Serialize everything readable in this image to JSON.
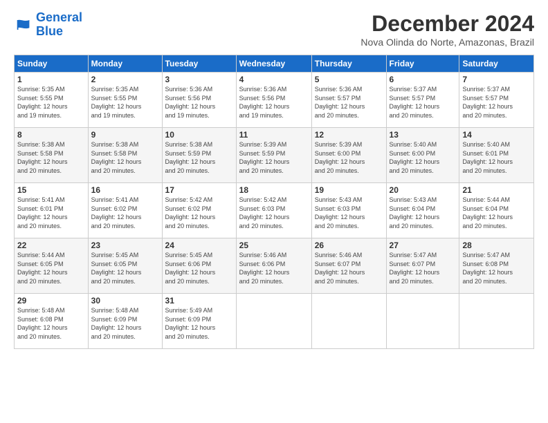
{
  "logo": {
    "line1": "General",
    "line2": "Blue"
  },
  "title": "December 2024",
  "subtitle": "Nova Olinda do Norte, Amazonas, Brazil",
  "days_of_week": [
    "Sunday",
    "Monday",
    "Tuesday",
    "Wednesday",
    "Thursday",
    "Friday",
    "Saturday"
  ],
  "weeks": [
    [
      {
        "day": "1",
        "info": "Sunrise: 5:35 AM\nSunset: 5:55 PM\nDaylight: 12 hours\nand 19 minutes."
      },
      {
        "day": "2",
        "info": "Sunrise: 5:35 AM\nSunset: 5:55 PM\nDaylight: 12 hours\nand 19 minutes."
      },
      {
        "day": "3",
        "info": "Sunrise: 5:36 AM\nSunset: 5:56 PM\nDaylight: 12 hours\nand 19 minutes."
      },
      {
        "day": "4",
        "info": "Sunrise: 5:36 AM\nSunset: 5:56 PM\nDaylight: 12 hours\nand 19 minutes."
      },
      {
        "day": "5",
        "info": "Sunrise: 5:36 AM\nSunset: 5:57 PM\nDaylight: 12 hours\nand 20 minutes."
      },
      {
        "day": "6",
        "info": "Sunrise: 5:37 AM\nSunset: 5:57 PM\nDaylight: 12 hours\nand 20 minutes."
      },
      {
        "day": "7",
        "info": "Sunrise: 5:37 AM\nSunset: 5:57 PM\nDaylight: 12 hours\nand 20 minutes."
      }
    ],
    [
      {
        "day": "8",
        "info": "Sunrise: 5:38 AM\nSunset: 5:58 PM\nDaylight: 12 hours\nand 20 minutes."
      },
      {
        "day": "9",
        "info": "Sunrise: 5:38 AM\nSunset: 5:58 PM\nDaylight: 12 hours\nand 20 minutes."
      },
      {
        "day": "10",
        "info": "Sunrise: 5:38 AM\nSunset: 5:59 PM\nDaylight: 12 hours\nand 20 minutes."
      },
      {
        "day": "11",
        "info": "Sunrise: 5:39 AM\nSunset: 5:59 PM\nDaylight: 12 hours\nand 20 minutes."
      },
      {
        "day": "12",
        "info": "Sunrise: 5:39 AM\nSunset: 6:00 PM\nDaylight: 12 hours\nand 20 minutes."
      },
      {
        "day": "13",
        "info": "Sunrise: 5:40 AM\nSunset: 6:00 PM\nDaylight: 12 hours\nand 20 minutes."
      },
      {
        "day": "14",
        "info": "Sunrise: 5:40 AM\nSunset: 6:01 PM\nDaylight: 12 hours\nand 20 minutes."
      }
    ],
    [
      {
        "day": "15",
        "info": "Sunrise: 5:41 AM\nSunset: 6:01 PM\nDaylight: 12 hours\nand 20 minutes."
      },
      {
        "day": "16",
        "info": "Sunrise: 5:41 AM\nSunset: 6:02 PM\nDaylight: 12 hours\nand 20 minutes."
      },
      {
        "day": "17",
        "info": "Sunrise: 5:42 AM\nSunset: 6:02 PM\nDaylight: 12 hours\nand 20 minutes."
      },
      {
        "day": "18",
        "info": "Sunrise: 5:42 AM\nSunset: 6:03 PM\nDaylight: 12 hours\nand 20 minutes."
      },
      {
        "day": "19",
        "info": "Sunrise: 5:43 AM\nSunset: 6:03 PM\nDaylight: 12 hours\nand 20 minutes."
      },
      {
        "day": "20",
        "info": "Sunrise: 5:43 AM\nSunset: 6:04 PM\nDaylight: 12 hours\nand 20 minutes."
      },
      {
        "day": "21",
        "info": "Sunrise: 5:44 AM\nSunset: 6:04 PM\nDaylight: 12 hours\nand 20 minutes."
      }
    ],
    [
      {
        "day": "22",
        "info": "Sunrise: 5:44 AM\nSunset: 6:05 PM\nDaylight: 12 hours\nand 20 minutes."
      },
      {
        "day": "23",
        "info": "Sunrise: 5:45 AM\nSunset: 6:05 PM\nDaylight: 12 hours\nand 20 minutes."
      },
      {
        "day": "24",
        "info": "Sunrise: 5:45 AM\nSunset: 6:06 PM\nDaylight: 12 hours\nand 20 minutes."
      },
      {
        "day": "25",
        "info": "Sunrise: 5:46 AM\nSunset: 6:06 PM\nDaylight: 12 hours\nand 20 minutes."
      },
      {
        "day": "26",
        "info": "Sunrise: 5:46 AM\nSunset: 6:07 PM\nDaylight: 12 hours\nand 20 minutes."
      },
      {
        "day": "27",
        "info": "Sunrise: 5:47 AM\nSunset: 6:07 PM\nDaylight: 12 hours\nand 20 minutes."
      },
      {
        "day": "28",
        "info": "Sunrise: 5:47 AM\nSunset: 6:08 PM\nDaylight: 12 hours\nand 20 minutes."
      }
    ],
    [
      {
        "day": "29",
        "info": "Sunrise: 5:48 AM\nSunset: 6:08 PM\nDaylight: 12 hours\nand 20 minutes."
      },
      {
        "day": "30",
        "info": "Sunrise: 5:48 AM\nSunset: 6:09 PM\nDaylight: 12 hours\nand 20 minutes."
      },
      {
        "day": "31",
        "info": "Sunrise: 5:49 AM\nSunset: 6:09 PM\nDaylight: 12 hours\nand 20 minutes."
      },
      null,
      null,
      null,
      null
    ]
  ]
}
